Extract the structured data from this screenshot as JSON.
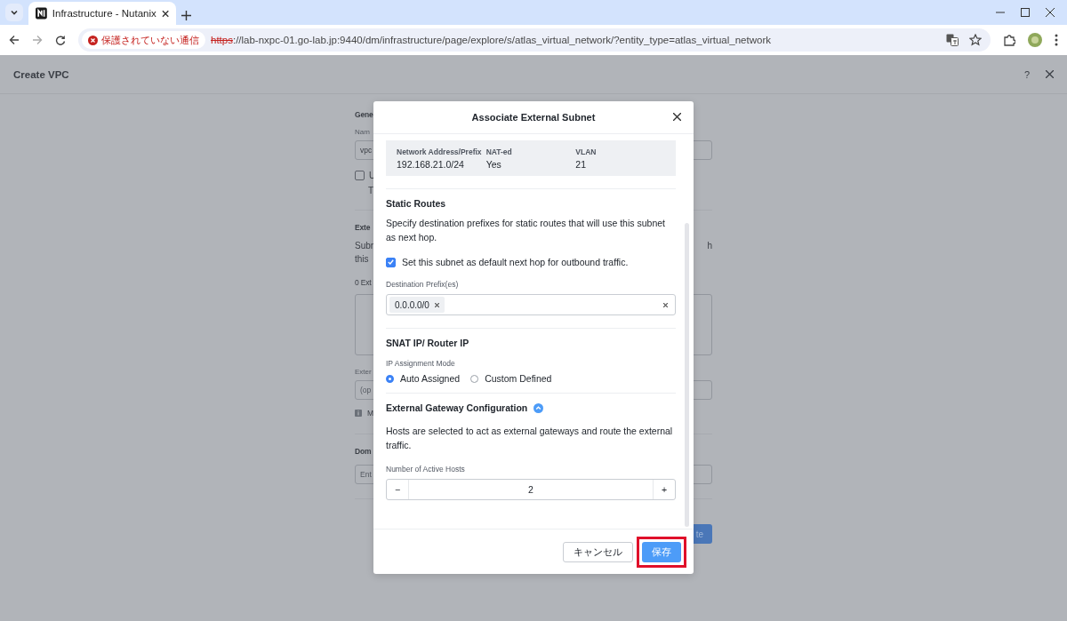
{
  "browser": {
    "tab_title": "Infrastructure - Nutanix",
    "security_label": "保護されていない通信",
    "url_scheme": "https",
    "url_rest": "://lab-nxpc-01.go-lab.jp:9440/dm/infrastructure/page/explore/s/atlas_virtual_network/?entity_type=atlas_virtual_network"
  },
  "page": {
    "title": "Create VPC",
    "help": "?"
  },
  "background_form": [
    {
      "kind": "heading",
      "text": "Gene"
    },
    {
      "kind": "label",
      "text": "Nam"
    },
    {
      "kind": "input",
      "value": "vpc"
    },
    {
      "kind": "checkbox",
      "text": "U",
      "checked": false
    },
    {
      "kind": "note",
      "text": "T"
    },
    {
      "kind": "divider"
    },
    {
      "kind": "heading",
      "text": "Exte"
    },
    {
      "kind": "text",
      "text": "Subn",
      "right": "h"
    },
    {
      "kind": "text",
      "text": "this"
    },
    {
      "kind": "count",
      "text": "0 Ext"
    },
    {
      "kind": "textarea"
    },
    {
      "kind": "label",
      "text": "Exter"
    },
    {
      "kind": "input",
      "placeholder": "(op"
    },
    {
      "kind": "info",
      "text": "M"
    },
    {
      "kind": "divider"
    },
    {
      "kind": "heading",
      "text": "Dom"
    },
    {
      "kind": "input",
      "placeholder": "Ent"
    },
    {
      "kind": "divider"
    },
    {
      "kind": "button",
      "text": "te"
    }
  ],
  "modal": {
    "title": "Associate External Subnet",
    "summary": [
      {
        "label": "Network Address/Prefix",
        "value": "192.168.21.0/24"
      },
      {
        "label": "NAT-ed",
        "value": "Yes"
      },
      {
        "label": "VLAN",
        "value": "21"
      }
    ],
    "static_routes": {
      "heading": "Static Routes",
      "description": "Specify destination prefixes for static routes that will use this subnet as next hop.",
      "default_hop": {
        "label": "Set this subnet as default next hop for outbound traffic.",
        "checked": true
      },
      "prefix_label": "Destination Prefix(es)",
      "prefixes": [
        "0.0.0.0/0"
      ]
    },
    "snat": {
      "heading": "SNAT IP/ Router IP",
      "mode_label": "IP Assignment Mode",
      "options": [
        {
          "label": "Auto Assigned",
          "selected": true
        },
        {
          "label": "Custom Defined",
          "selected": false
        }
      ]
    },
    "gateway": {
      "heading": "External Gateway Configuration",
      "expanded": true,
      "description": "Hosts are selected to act as external gateways and route the external traffic.",
      "hosts_label": "Number of Active Hosts",
      "hosts": "2",
      "minus": "−",
      "plus": "+"
    },
    "buttons": [
      {
        "label": "キャンセル",
        "kind": "secondary",
        "highlighted": false
      },
      {
        "label": "保存",
        "kind": "primary",
        "highlighted": true
      }
    ]
  }
}
